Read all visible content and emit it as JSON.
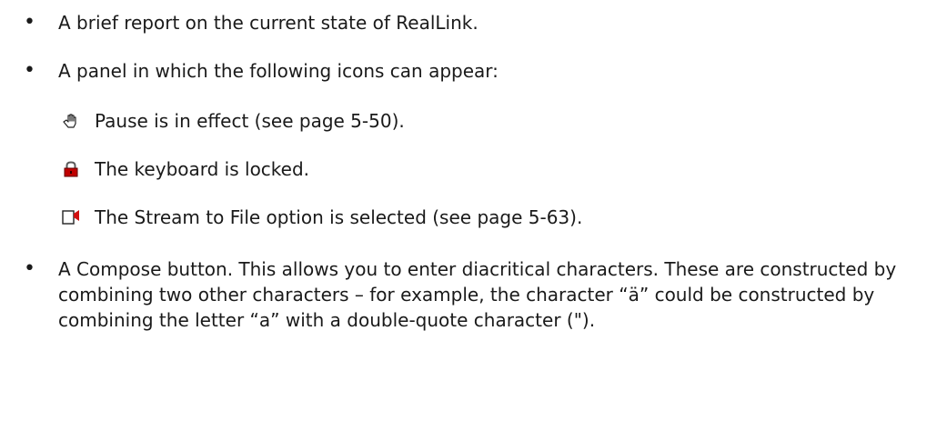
{
  "bullets": [
    {
      "text": "A brief report on the current state of RealLink."
    },
    {
      "text": "A panel in which the following icons can appear:"
    },
    {
      "text": "A Compose button. This allows you to enter diacritical characters. These are constructed by combining two other characters – for example, the character “ä” could be constructed by combining the letter “a” with a double-quote character (\")."
    }
  ],
  "icons": [
    {
      "icon": "pause-hand-icon",
      "text": "Pause is in effect (see page 5-50)."
    },
    {
      "icon": "keyboard-lock-icon",
      "text": "The keyboard is locked."
    },
    {
      "icon": "stream-to-file-icon",
      "text": "The Stream to File option is selected (see page 5-63)."
    }
  ],
  "bullet_symbol": "•",
  "colors": {
    "text": "#1a1a1a",
    "lock_red": "#c00000",
    "stream_red": "#d01010"
  }
}
